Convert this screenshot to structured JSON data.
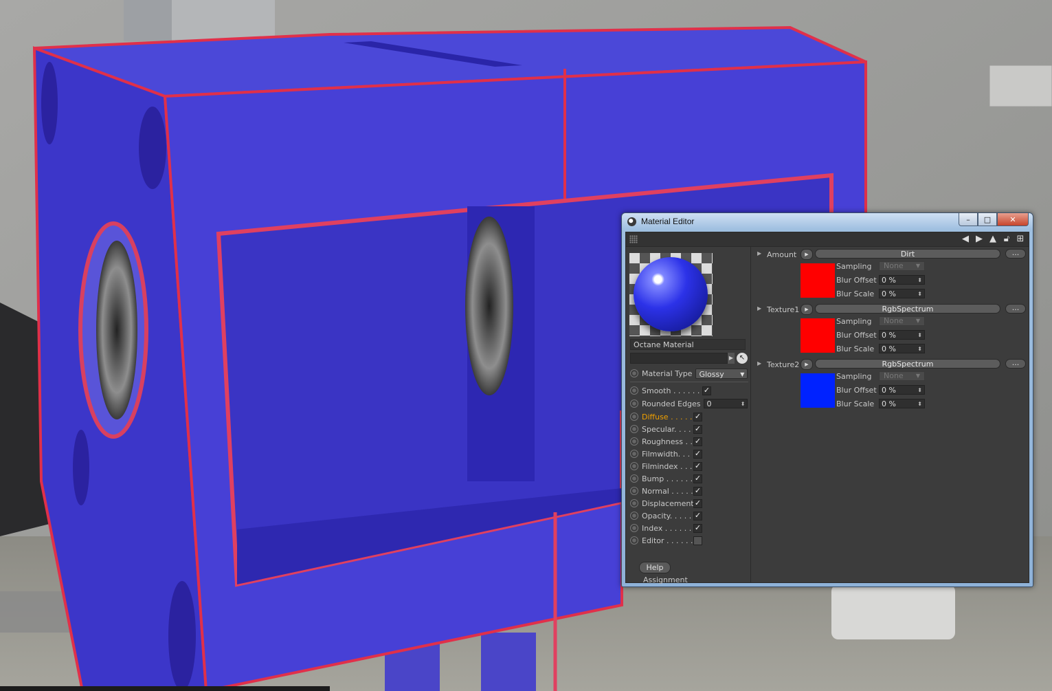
{
  "window": {
    "title": "Material Editor",
    "controls": {
      "minimize": "–",
      "maximize": "□",
      "close": "✕"
    }
  },
  "toolbar": {
    "icons": [
      "grip-icon",
      "arrow-left-icon",
      "arrow-right-icon",
      "cursor-icon",
      "lock-icon",
      "new-window-icon"
    ]
  },
  "material": {
    "name": "Octane Material",
    "path_value": "",
    "type_label": "Material Type",
    "type_value": "Glossy"
  },
  "channels": [
    {
      "label": "Smooth . . . . . .",
      "checked": true
    },
    {
      "label": "Rounded Edges",
      "value": "0"
    },
    {
      "label": "Diffuse . . . . .",
      "checked": true,
      "active": true
    },
    {
      "label": "Specular. . . .",
      "checked": true
    },
    {
      "label": "Roughness . .",
      "checked": true
    },
    {
      "label": "Filmwidth. . .",
      "checked": true
    },
    {
      "label": "Filmindex . . .",
      "checked": true
    },
    {
      "label": "Bump . . . . . .",
      "checked": true
    },
    {
      "label": "Normal . . . . .",
      "checked": true
    },
    {
      "label": "Displacement",
      "checked": true
    },
    {
      "label": "Opacity. . . . .",
      "checked": true
    },
    {
      "label": "Index . . . . . .",
      "checked": true
    },
    {
      "label": "Editor . . . . . .",
      "checked": false
    }
  ],
  "help_label": "Help",
  "assignment_label": "Assignment",
  "shaders": [
    {
      "label": "Amount",
      "shader": "Dirt",
      "dots": "...",
      "color": "#ff0000",
      "sampling_label": "Sampling",
      "sampling_value": "None",
      "blur_offset_label": "Blur Offset",
      "blur_offset_value": "0 %",
      "blur_scale_label": "Blur Scale",
      "blur_scale_value": "0 %"
    },
    {
      "label": "Texture1",
      "shader": "RgbSpectrum",
      "dots": "...",
      "color": "#ff0000",
      "sampling_label": "Sampling",
      "sampling_value": "None",
      "blur_offset_label": "Blur Offset",
      "blur_offset_value": "0 %",
      "blur_scale_label": "Blur Scale",
      "blur_scale_value": "0 %"
    },
    {
      "label": "Texture2",
      "shader": "RgbSpectrum",
      "dots": "...",
      "color": "#0022ff",
      "sampling_label": "Sampling",
      "sampling_value": "None",
      "blur_offset_label": "Blur Offset",
      "blur_offset_value": "0 %",
      "blur_scale_label": "Blur Scale",
      "blur_scale_value": "0 %"
    }
  ]
}
